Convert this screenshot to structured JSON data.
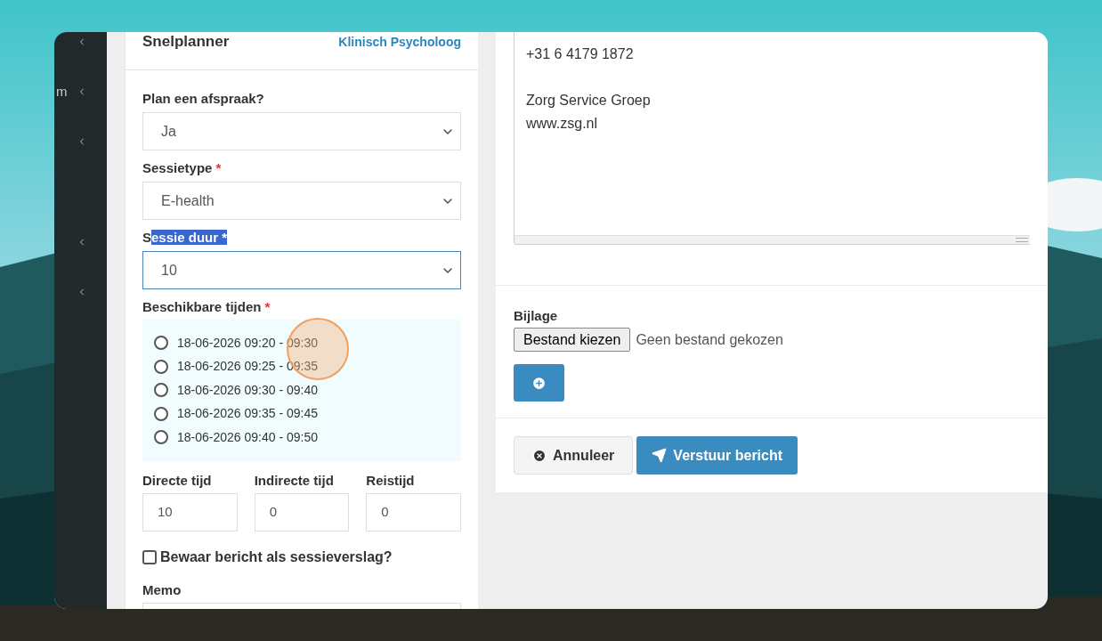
{
  "sidebar": {
    "label": "m"
  },
  "planner": {
    "title": "Snelplanner",
    "role_link": "Klinisch Psycholoog",
    "fields": [
      {
        "label": "Plan een afspraak?",
        "highlighted": false,
        "value": "Ja",
        "focused": false
      },
      {
        "label": "Sessietype",
        "required_mark": "*",
        "highlighted": false,
        "value": "E-health",
        "focused": false
      },
      {
        "label": "Sessie duur",
        "required_mark": "*",
        "highlighted": true,
        "value": "10",
        "focused": true
      }
    ],
    "slots_label": "Beschikbare tijden",
    "slots_required_mark": "*",
    "slots": [
      {
        "label": "18-06-2026 09:20 - 09:30",
        "selected": false
      },
      {
        "label": "18-06-2026 09:25 - 09:35",
        "selected": false
      },
      {
        "label": "18-06-2026 09:30 - 09:40",
        "selected": false
      },
      {
        "label": "18-06-2026 09:35 - 09:45",
        "selected": false
      },
      {
        "label": "18-06-2026 09:40 - 09:50",
        "selected": false
      }
    ],
    "times": [
      {
        "label": "Directe tijd",
        "value": "10"
      },
      {
        "label": "Indirecte tijd",
        "value": "0"
      },
      {
        "label": "Reistijd",
        "value": "0"
      }
    ],
    "save_report": {
      "label": "Bewaar bericht als sessieverslag?",
      "checked": false
    },
    "memo_label": "Memo"
  },
  "message": {
    "paragraphs": [
      [
        "+31 6 4179 1872"
      ],
      [
        "Zorg Service Groep",
        "www.zsg.nl"
      ]
    ],
    "attachment_label": "Bijlage",
    "file_button": "Bestand kiezen",
    "file_status": "Geen bestand gekozen",
    "cancel": "Annuleer",
    "send": "Verstuur bericht"
  }
}
